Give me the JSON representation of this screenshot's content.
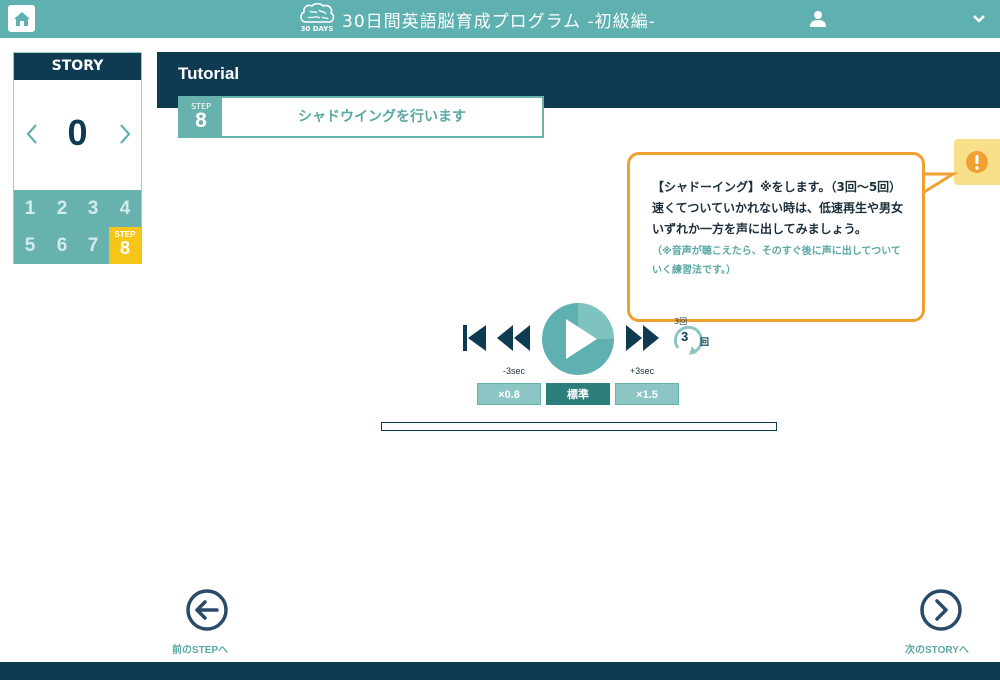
{
  "header": {
    "brand_logo_text": "30 DAYS",
    "title": "30日間英語脳育成プログラム -初級編-"
  },
  "sidebar": {
    "title": "STORY",
    "story_number": "0",
    "steps": [
      "1",
      "2",
      "3",
      "4",
      "5",
      "6",
      "7"
    ],
    "active_step_label": "STEP",
    "active_step_number": "8"
  },
  "main": {
    "section_title": "Tutorial",
    "step_label": "STEP",
    "step_number": "8",
    "step_text": "シャドウイングを行います"
  },
  "tip": {
    "text": "【シャドーイング】※をします。（3回～5回）速くてついていかれない時は、低速再生や男女いずれか一方を声に出してみましょう。",
    "note": "（※音声が聴こえたら、そのすぐ後に声に出してついていく練習法です。）"
  },
  "player": {
    "rewind_label": "-3sec",
    "forward_label": "+3sec",
    "repeat_top_label": "3回",
    "repeat_count": "3",
    "repeat_unit": "回",
    "speeds": [
      "×0.8",
      "標準",
      "×1.5"
    ],
    "selected_speed_index": 1,
    "progress": 0
  },
  "footer_nav": {
    "prev_label": "前のSTEPへ",
    "next_label": "次のSTORYへ"
  },
  "colors": {
    "teal": "#5fb1b1",
    "navy": "#0e3a52",
    "accent_yellow": "#f5c518",
    "bubble_border": "#f0a030"
  }
}
